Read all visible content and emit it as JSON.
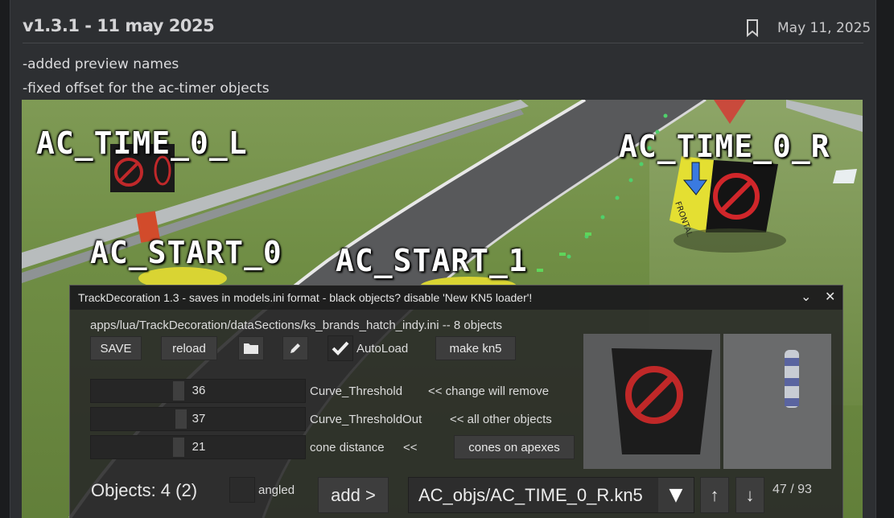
{
  "post": {
    "title": "v1.3.1 - 11 may 2025",
    "date": "May 11, 2025",
    "notes": [
      "-added preview names",
      "-fixed offset for the ac-timer objects"
    ]
  },
  "scene": {
    "labels": [
      "AC_TIME_0_L",
      "AC_TIME_0_R",
      "AC_START_0",
      "AC_START_1"
    ],
    "frontal_text": "FRONTAL"
  },
  "tool": {
    "title": "TrackDecoration 1.3 - saves in models.ini format - black objects? disable 'New KN5 loader'!",
    "path": "apps/lua/TrackDecoration/dataSections/ks_brands_hatch_indy.ini -- 8 objects",
    "buttons": {
      "save": "SAVE",
      "reload": "reload",
      "autoload": "AutoLoad",
      "make_kn5": "make kn5",
      "cones_on_apexes": "cones on apexes",
      "add": "add >",
      "up": "↑",
      "down": "↓"
    },
    "folder_icon": "folder-icon",
    "edit_icon": "pencil-icon",
    "autoload_checked": true,
    "sliders": [
      {
        "value": "36",
        "label": "Curve_Threshold",
        "note": "<< change will remove",
        "fraction": 0.4
      },
      {
        "value": "37",
        "label": "Curve_ThresholdOut",
        "note": "<< all other objects",
        "fraction": 0.41
      },
      {
        "value": "21",
        "label": "cone distance",
        "note": "<<",
        "fraction": 0.38
      }
    ],
    "objects_label": "Objects: 4  (2)",
    "angled_label": "angled",
    "angled_checked": false,
    "selected_object": "AC_objs/AC_TIME_0_R.kn5",
    "counter": "47 / 93"
  }
}
